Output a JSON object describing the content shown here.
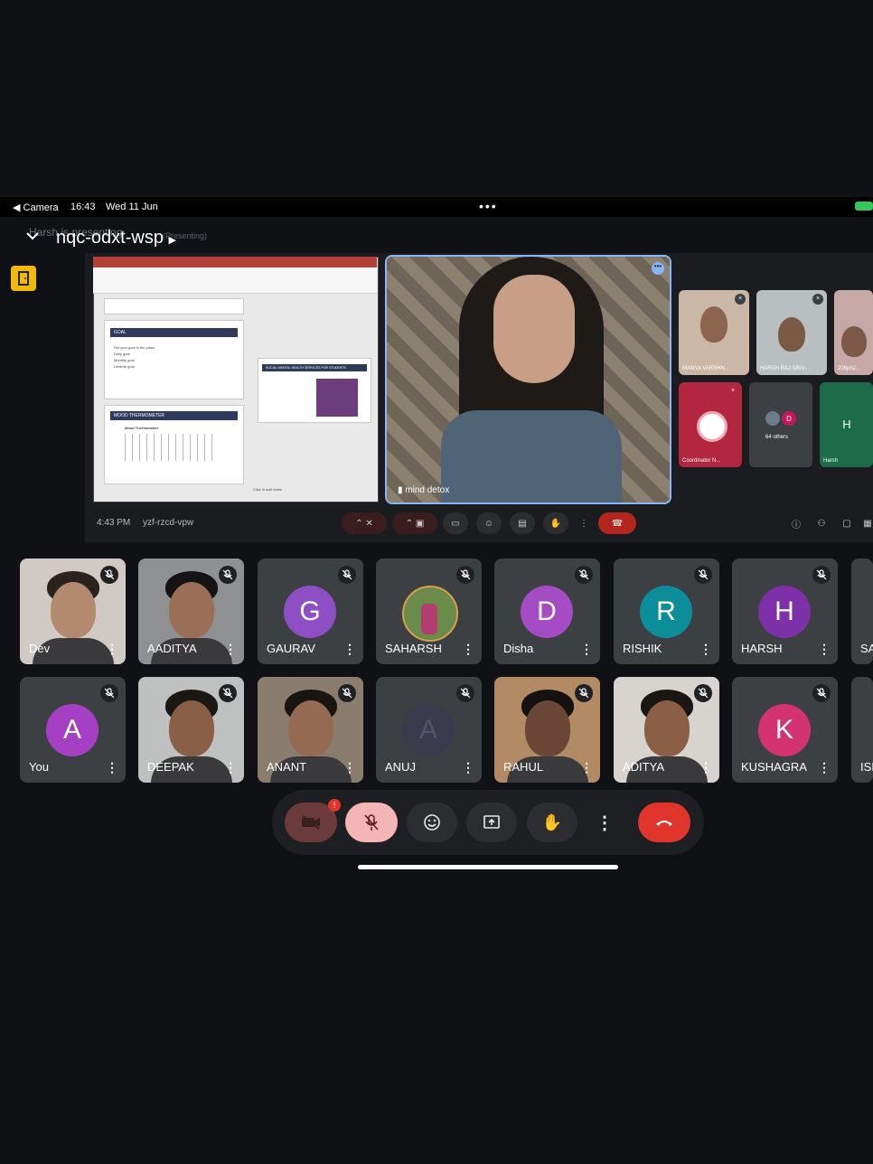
{
  "status_bar": {
    "back_label": "◀ Camera",
    "time": "16:43",
    "date": "Wed 11 Jun",
    "more": "•••"
  },
  "meeting": {
    "code": "nqc-odxt-wsp",
    "ghost_text": "Harsh is presenting",
    "ghost_text2": "(Presenting)"
  },
  "inner": {
    "time": "4:43 PM",
    "code": "yzf-rzcd-vpw",
    "slides": [
      {
        "title": "GOAL",
        "bullets": [
          "Set your goal in the plans",
          "Daily goal",
          "Monthly goal",
          "Lifetime goal"
        ]
      },
      {
        "title": "MOOD THERMOMETER",
        "subtitle": "Mood Thermometer"
      }
    ],
    "main_slide": {
      "title": "SOCIAL MENTAL HEALTH SERVICES FOR STUDENTS"
    },
    "notes": "Click to add notes",
    "speaker_name": "mind detox",
    "mini_tiles": [
      {
        "label": "MANYA VARSHN...",
        "color": "#cbb7a6"
      },
      {
        "label": "HARSH RAJ SRIV...",
        "color": "#b9bec1"
      },
      {
        "label": "20bph2...",
        "color": "#c6a9a6"
      },
      {
        "label": "Coordinator N...",
        "color": "#b2263f"
      },
      {
        "label": "64 others",
        "color": "#3c4043"
      },
      {
        "label": "Harsh",
        "color": "#1e6b4c",
        "letter": "H"
      }
    ],
    "others_badge_letter": "D"
  },
  "participants": [
    {
      "name": "Dev",
      "type": "photo",
      "bg": "#cfcac4",
      "skin": "#b48a6f",
      "hair": "#2a221d"
    },
    {
      "name": "AADITYA",
      "type": "photo",
      "bg": "#8f9092",
      "skin": "#9b6f55",
      "hair": "#151313"
    },
    {
      "name": "GAURAV",
      "type": "letter",
      "letter": "G",
      "color": "#8f4fc4"
    },
    {
      "name": "SAHARSH",
      "type": "avatar",
      "bg": "#3c4043"
    },
    {
      "name": "Disha",
      "type": "letter",
      "letter": "D",
      "color": "#a54bc4"
    },
    {
      "name": "RISHIK",
      "type": "letter",
      "letter": "R",
      "color": "#0b8e9a"
    },
    {
      "name": "HARSH",
      "type": "letter",
      "letter": "H",
      "color": "#7e30a8"
    },
    {
      "name": "SA",
      "type": "partial"
    },
    {
      "name": "You",
      "type": "letter",
      "letter": "A",
      "color": "#a53fc4"
    },
    {
      "name": "DEEPAK",
      "type": "photo",
      "bg": "#bfc1c0",
      "skin": "#8a5f48",
      "hair": "#1b1715"
    },
    {
      "name": "ANANT",
      "type": "photo",
      "bg": "#8a7d6d",
      "skin": "#946b52",
      "hair": "#1a1512"
    },
    {
      "name": "ANUJ",
      "type": "letter-dim",
      "letter": "A",
      "color": "#3c3a4d"
    },
    {
      "name": "RAHUL",
      "type": "photo",
      "bg": "#b28a63",
      "skin": "#6a4636",
      "hair": "#141110"
    },
    {
      "name": "ADITYA",
      "type": "photo",
      "bg": "#d7d3cf",
      "skin": "#8b5e46",
      "hair": "#1a1614"
    },
    {
      "name": "KUSHAGRA",
      "type": "letter",
      "letter": "K",
      "color": "#d3336f"
    },
    {
      "name": "ISI",
      "type": "partial"
    }
  ],
  "controls": {
    "camera_badge": "!"
  },
  "colors": {
    "end_call": "#e0352b",
    "mic_off": "#f4b6b4",
    "cam_off": "#6b3a3a",
    "accent": "#8ab4f8"
  }
}
